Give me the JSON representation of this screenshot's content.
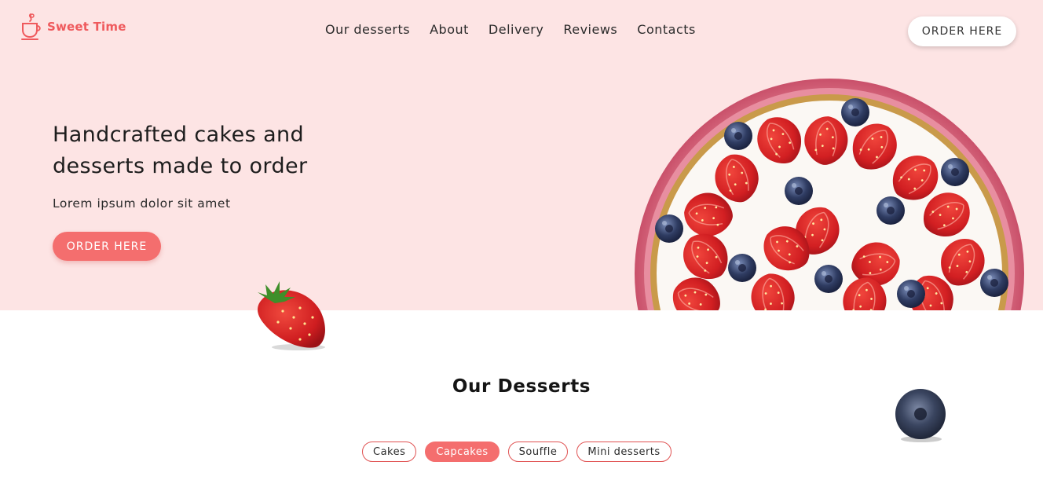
{
  "brand": {
    "name": "Sweet Time",
    "icon": "cup-icon",
    "color": "#ef5a5d"
  },
  "nav": {
    "items": [
      {
        "label": "Our desserts"
      },
      {
        "label": "About"
      },
      {
        "label": "Delivery"
      },
      {
        "label": "Reviews"
      },
      {
        "label": "Contacts"
      }
    ],
    "order_button": "ORDER HERE"
  },
  "hero": {
    "headline": "Handcrafted cakes and desserts made to order",
    "subline": "Lorem ipsum dolor sit amet",
    "order_button": "ORDER HERE",
    "background": "#fde4e4",
    "accent": "#f46e6e"
  },
  "desserts": {
    "title": "Our Desserts",
    "filters": [
      {
        "label": "Cakes",
        "active": false
      },
      {
        "label": "Capcakes",
        "active": true
      },
      {
        "label": "Souffle",
        "active": false
      },
      {
        "label": "Mini desserts",
        "active": false
      }
    ]
  }
}
